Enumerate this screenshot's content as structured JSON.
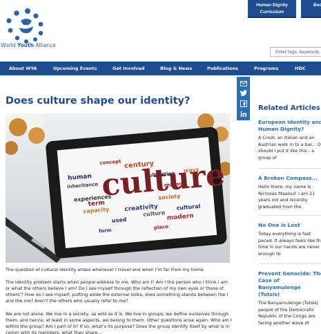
{
  "brand": {
    "name_part1": "World ",
    "name_part2": "Youth",
    "name_part3": " Alliance"
  },
  "top_buttons": [
    {
      "label": "Human Dignity Curriculum"
    },
    {
      "label": "Beo M"
    }
  ],
  "search": {
    "placeholder": "Enter tags, keywords, ..."
  },
  "nav": [
    {
      "label": "About WYA"
    },
    {
      "label": "Upcoming Events"
    },
    {
      "label": "Get Involved"
    },
    {
      "label": "Blog & News"
    },
    {
      "label": "Publications"
    },
    {
      "label": "Programs"
    },
    {
      "label": "HDC"
    }
  ],
  "social": [
    "mail-icon",
    "twitter-icon",
    "facebook-icon",
    "linkedin-icon"
  ],
  "article": {
    "title": "Does culture shape our identity?",
    "hero_word": "culture",
    "hero_small_words": [
      "concept",
      "human",
      "century",
      "society",
      "cultivation",
      "creativity",
      "reason",
      "experiences",
      "capacity",
      "inheritance",
      "cultural",
      "modern",
      "used",
      "term",
      "ways",
      "culture",
      "form",
      "place"
    ],
    "paragraphs": [
      "The question of cultural identity arises whenever I travel and when I’m far from my home.",
      "The identity problem starts when people address to me. Who am I? Am I the person who I think I am or what the others believe I am? Do I see myself through the reflection of my own eyes or those of others’? How do I see myself, putting aside the external looks, does something stands between the I and the me? Aren’t the others who usually refer to me?",
      "We are not alone. We live in a society, as wild as it is. We live in groups, we define ourselves through them, and hence, at least in some aspects, we belong to them. Other questions arise again: Who am I within the group? Am I part of it? If so, what’s its purpose? Does the group identify itself by what is in comm with its members, what they share..."
    ]
  },
  "related": {
    "heading": "Related Articles",
    "items": [
      {
        "title": "European Identity and Human Dignity?",
        "excerpt": "A Croat, an Italian and an Austrian walk in to a bar... Or should I put it like this - a group of"
      },
      {
        "title": "A Broken Compass...",
        "excerpt": "Hello there, my name is Nicholas Maalouf. I am 21 years old and recently graduated from the"
      },
      {
        "title": "No One Is Lost",
        "excerpt": "Today everything is fast paced. It always feels like the time in our hands are never enough to"
      },
      {
        "title": "Prevent Genocide: The Case of Banyamulenge (Tutsis)",
        "excerpt": "The Banyamulenge (Tutsis) people of the Democratic Republic of the Congo are facing another wave of"
      }
    ]
  }
}
